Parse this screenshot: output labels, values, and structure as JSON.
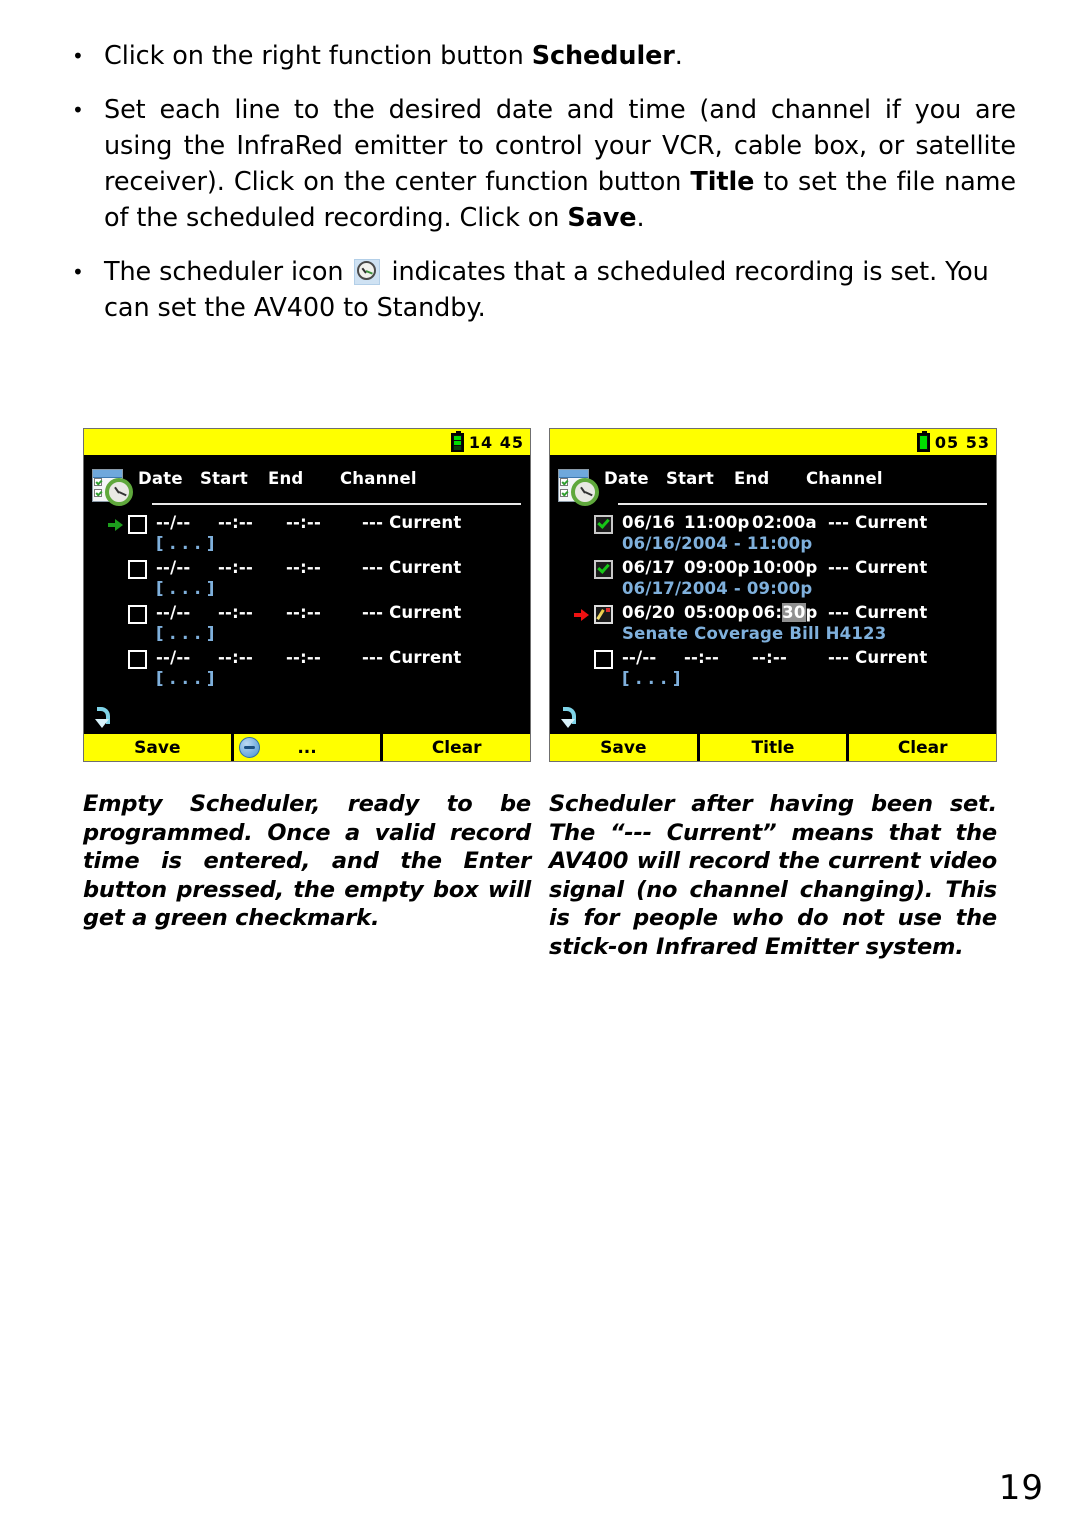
{
  "instructions": [
    {
      "id": "bullet-scheduler",
      "segments": [
        {
          "text": "Click on the right function button ",
          "bold": false
        },
        {
          "text": "Scheduler",
          "bold": true
        },
        {
          "text": ".",
          "bold": false
        }
      ],
      "justify": false
    },
    {
      "id": "bullet-set-lines",
      "segments": [
        {
          "text": "Set each line to the desired date and time (and channel if you are using the InfraRed emitter to control your VCR, cable box, or satellite receiver). Click on the center function button ",
          "bold": false
        },
        {
          "text": "Title",
          "bold": true
        },
        {
          "text": " to set the file name of the scheduled recording. Click on ",
          "bold": false
        },
        {
          "text": "Save",
          "bold": true
        },
        {
          "text": ".",
          "bold": false
        }
      ],
      "justify": true
    },
    {
      "id": "bullet-scheduler-icon",
      "segments": [
        {
          "text": "The scheduler icon ",
          "bold": false
        },
        {
          "icon": "clock-icon"
        },
        {
          "text": " indicates that a scheduled recording is set. You can set the AV400 to Standby.",
          "bold": false
        }
      ],
      "justify": false
    }
  ],
  "devices": [
    {
      "id": "device-empty-scheduler",
      "status": {
        "battery_icon": "battery-partial-icon",
        "battery_level": "partial",
        "clock": "14 45"
      },
      "app_icon": "scheduler-checklist-clock-icon",
      "columns": [
        "Date",
        "Start",
        "End",
        "Channel"
      ],
      "rows": [
        {
          "marker": "green-arrow-icon",
          "marker_color": "#1d9e1d",
          "checkbox": "empty",
          "date": "--/--",
          "start": "--:--",
          "end": "--:--",
          "channel": "--- Current",
          "title": "[ . . . ]",
          "highlight": ""
        },
        {
          "marker": "",
          "marker_color": "",
          "checkbox": "empty",
          "date": "--/--",
          "start": "--:--",
          "end": "--:--",
          "channel": "--- Current",
          "title": "[ . . . ]",
          "highlight": ""
        },
        {
          "marker": "",
          "marker_color": "",
          "checkbox": "empty",
          "date": "--/--",
          "start": "--:--",
          "end": "--:--",
          "channel": "--- Current",
          "title": "[ . . . ]",
          "highlight": ""
        },
        {
          "marker": "",
          "marker_color": "",
          "checkbox": "empty",
          "date": "--/--",
          "start": "--:--",
          "end": "--:--",
          "channel": "--- Current",
          "title": "[ . . . ]",
          "highlight": ""
        }
      ],
      "scroll_indicator": "scroll-down-arrow-icon",
      "toolbar": [
        {
          "label": "Save",
          "icon": ""
        },
        {
          "label": "...",
          "icon": "blue-circle-menu-icon"
        },
        {
          "label": "Clear",
          "icon": ""
        }
      ],
      "caption": "Empty Scheduler, ready to be programmed. Once a valid record time is entered, and the Enter button pressed, the empty box will get a green checkmark."
    },
    {
      "id": "device-set-scheduler",
      "status": {
        "battery_icon": "battery-full-icon",
        "battery_level": "full",
        "clock": "05 53"
      },
      "app_icon": "scheduler-checklist-clock-icon",
      "columns": [
        "Date",
        "Start",
        "End",
        "Channel"
      ],
      "rows": [
        {
          "marker": "",
          "marker_color": "",
          "checkbox": "checked",
          "date": "06/16",
          "start": "11:00p",
          "end": "02:00a",
          "channel": "--- Current",
          "title": "06/16/2004 - 11:00p",
          "highlight": ""
        },
        {
          "marker": "",
          "marker_color": "",
          "checkbox": "checked",
          "date": "06/17",
          "start": "09:00p",
          "end": "10:00p",
          "channel": "--- Current",
          "title": "06/17/2004 - 09:00p",
          "highlight": ""
        },
        {
          "marker": "red-arrow-icon",
          "marker_color": "#ee1111",
          "checkbox": "editing",
          "date": "06/20",
          "start": "05:00p",
          "end": "06:30p",
          "channel": "--- Current",
          "title": "Senate Coverage Bill H4123",
          "highlight": "30"
        },
        {
          "marker": "",
          "marker_color": "",
          "checkbox": "empty",
          "date": "--/--",
          "start": "--:--",
          "end": "--:--",
          "channel": "--- Current",
          "title": "[ . . . ]",
          "highlight": ""
        }
      ],
      "scroll_indicator": "scroll-down-arrow-icon",
      "toolbar": [
        {
          "label": "Save",
          "icon": ""
        },
        {
          "label": "Title",
          "icon": ""
        },
        {
          "label": "Clear",
          "icon": ""
        }
      ],
      "caption": "Scheduler after having been set. The “--- Current” means that the AV400 will record the current video signal (no channel changing). This is for people who do not use the stick-on Infrared Emitter system."
    }
  ],
  "page": {
    "number": "19"
  },
  "colors": {
    "status_bar": "#ffff00",
    "screen_bg": "#000000",
    "row_text": "#ffffff",
    "title_text": "#7fb0dc",
    "check_green": "#17c617",
    "marker_green": "#1d9e1d",
    "marker_red": "#ee1111",
    "highlight_bg": "#909090"
  }
}
